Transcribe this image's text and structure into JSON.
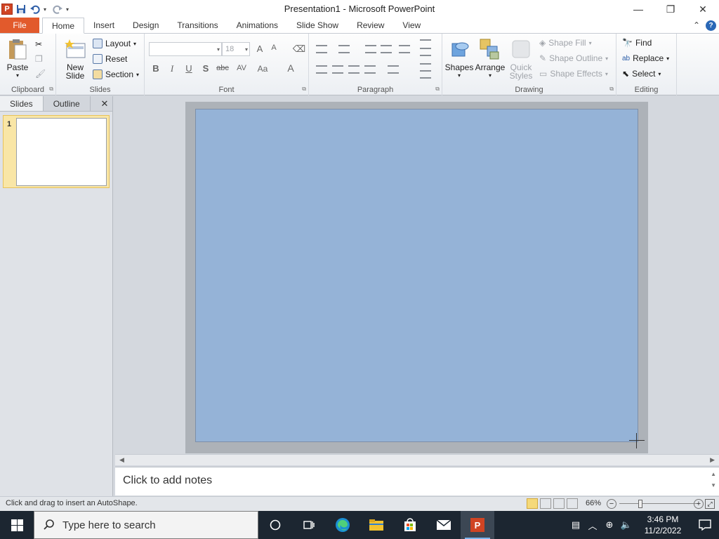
{
  "window": {
    "title": "Presentation1  -  Microsoft PowerPoint",
    "controls": {
      "minimize": "—",
      "restore": "❐",
      "close": "✕"
    }
  },
  "qat": {
    "app_icon": "P",
    "save_icon": "save-icon",
    "undo_icon": "undo-icon",
    "redo_icon": "redo-icon"
  },
  "ribbon_tabs": [
    "File",
    "Home",
    "Insert",
    "Design",
    "Transitions",
    "Animations",
    "Slide Show",
    "Review",
    "View"
  ],
  "ribbon_tabs_right": {
    "collapse": "⌃",
    "help": "?"
  },
  "ribbon": {
    "clipboard": {
      "label": "Clipboard",
      "paste": "Paste"
    },
    "slides": {
      "label": "Slides",
      "new_slide": "New Slide",
      "layout": "Layout",
      "reset": "Reset",
      "section": "Section"
    },
    "font": {
      "label": "Font",
      "font_name": "",
      "font_size": "18",
      "bold": "B",
      "italic": "I",
      "underline": "U",
      "shadow": "S",
      "strike": "abc",
      "spacing": "AV",
      "case": "Aa",
      "color": "A",
      "grow": "A",
      "shrink": "A"
    },
    "paragraph": {
      "label": "Paragraph"
    },
    "drawing": {
      "label": "Drawing",
      "shapes": "Shapes",
      "arrange": "Arrange",
      "quick_styles": "Quick Styles",
      "shape_fill": "Shape Fill",
      "shape_outline": "Shape Outline",
      "shape_effects": "Shape Effects"
    },
    "editing": {
      "label": "Editing",
      "find": "Find",
      "replace": "Replace",
      "select": "Select"
    }
  },
  "left_pane": {
    "tabs": [
      "Slides",
      "Outline"
    ],
    "close": "✕",
    "slide_number": "1"
  },
  "notes": {
    "placeholder": "Click to add notes"
  },
  "status": {
    "text": "Click and drag to insert an AutoShape.",
    "zoom": "66%"
  },
  "taskbar": {
    "search_placeholder": "Type here to search",
    "time": "3:46 PM",
    "date": "11/2/2022"
  },
  "colors": {
    "slide_fill": "#95b3d7",
    "file_tab": "#e25a2c",
    "taskbar": "#1c2631"
  }
}
